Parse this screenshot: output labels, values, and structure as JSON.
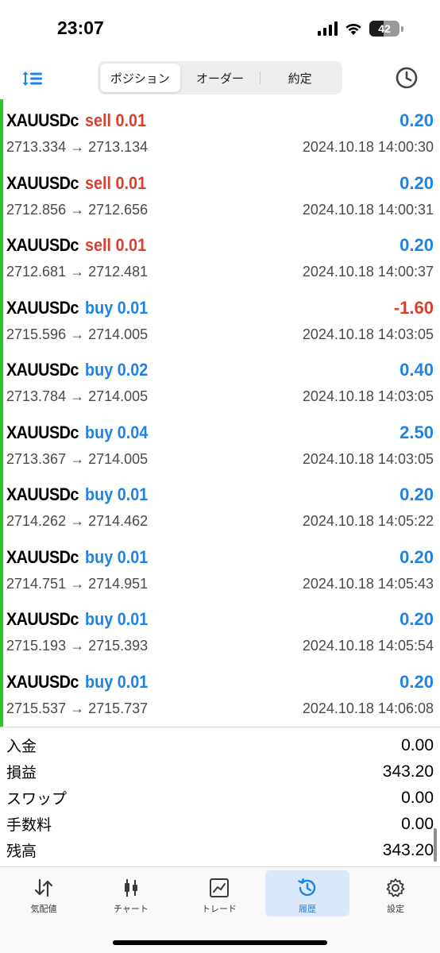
{
  "status": {
    "time": "23:07",
    "battery": "42"
  },
  "header": {
    "segments": [
      "ポジション",
      "オーダー",
      "約定"
    ],
    "active_segment": 0
  },
  "trades": [
    {
      "symbol": "XAUUSDc",
      "side": "sell",
      "volume": "0.01",
      "profit": "0.20",
      "open": "2713.334",
      "close": "2713.134",
      "time": "2024.10.18 14:00:30"
    },
    {
      "symbol": "XAUUSDc",
      "side": "sell",
      "volume": "0.01",
      "profit": "0.20",
      "open": "2712.856",
      "close": "2712.656",
      "time": "2024.10.18 14:00:31"
    },
    {
      "symbol": "XAUUSDc",
      "side": "sell",
      "volume": "0.01",
      "profit": "0.20",
      "open": "2712.681",
      "close": "2712.481",
      "time": "2024.10.18 14:00:37"
    },
    {
      "symbol": "XAUUSDc",
      "side": "buy",
      "volume": "0.01",
      "profit": "-1.60",
      "open": "2715.596",
      "close": "2714.005",
      "time": "2024.10.18 14:03:05"
    },
    {
      "symbol": "XAUUSDc",
      "side": "buy",
      "volume": "0.02",
      "profit": "0.40",
      "open": "2713.784",
      "close": "2714.005",
      "time": "2024.10.18 14:03:05"
    },
    {
      "symbol": "XAUUSDc",
      "side": "buy",
      "volume": "0.04",
      "profit": "2.50",
      "open": "2713.367",
      "close": "2714.005",
      "time": "2024.10.18 14:03:05"
    },
    {
      "symbol": "XAUUSDc",
      "side": "buy",
      "volume": "0.01",
      "profit": "0.20",
      "open": "2714.262",
      "close": "2714.462",
      "time": "2024.10.18 14:05:22"
    },
    {
      "symbol": "XAUUSDc",
      "side": "buy",
      "volume": "0.01",
      "profit": "0.20",
      "open": "2714.751",
      "close": "2714.951",
      "time": "2024.10.18 14:05:43"
    },
    {
      "symbol": "XAUUSDc",
      "side": "buy",
      "volume": "0.01",
      "profit": "0.20",
      "open": "2715.193",
      "close": "2715.393",
      "time": "2024.10.18 14:05:54"
    },
    {
      "symbol": "XAUUSDc",
      "side": "buy",
      "volume": "0.01",
      "profit": "0.20",
      "open": "2715.537",
      "close": "2715.737",
      "time": "2024.10.18 14:06:08"
    }
  ],
  "summary": [
    {
      "label": "入金",
      "value": "0.00"
    },
    {
      "label": "損益",
      "value": "343.20"
    },
    {
      "label": "スワップ",
      "value": "0.00"
    },
    {
      "label": "手数料",
      "value": "0.00"
    },
    {
      "label": "残高",
      "value": "343.20"
    }
  ],
  "tabs": [
    {
      "label": "気配値",
      "icon": "quotes-arrows-icon"
    },
    {
      "label": "チャート",
      "icon": "candlestick-chart-icon"
    },
    {
      "label": "トレード",
      "icon": "trade-line-chart-icon"
    },
    {
      "label": "履歴",
      "icon": "history-clock-icon"
    },
    {
      "label": "設定",
      "icon": "settings-gear-icon"
    }
  ],
  "active_tab": 3,
  "colors": {
    "accent_blue": "#1d83e6",
    "sell_red": "#d93f2e",
    "list_marker_green": "#2ec42e",
    "active_tab_bg": "#dbe9fa"
  }
}
